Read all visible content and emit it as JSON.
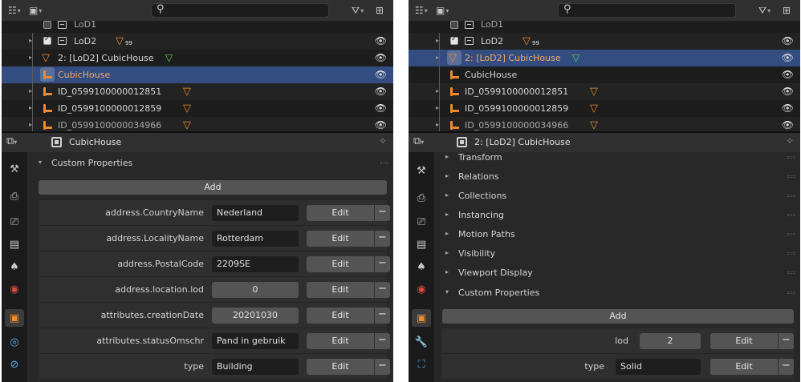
{
  "outliner": {
    "rows": [
      {
        "label": "LoD1"
      },
      {
        "label": "LoD2",
        "badge": "99"
      },
      {
        "label": "2: [LoD2] CubicHouse"
      },
      {
        "label": "CubicHouse"
      },
      {
        "label": "ID_0599100000012851"
      },
      {
        "label": "ID_0599100000012859"
      },
      {
        "label": "ID_0599100000034966"
      }
    ]
  },
  "left": {
    "header_title": "CubicHouse",
    "section": "Custom Properties",
    "add_label": "Add",
    "edit_label": "Edit",
    "remove_label": "−",
    "props": [
      {
        "key": "address.CountryName",
        "value": "Nederland"
      },
      {
        "key": "address.LocalityName",
        "value": "Rotterdam"
      },
      {
        "key": "address.PostalCode",
        "value": "2209SE"
      },
      {
        "key": "address.location.lod",
        "value": "0"
      },
      {
        "key": "attributes.creationDate",
        "value": "20201030"
      },
      {
        "key": "attributes.statusOmschr",
        "value": "Pand in gebruik"
      },
      {
        "key": "type",
        "value": "Building"
      }
    ]
  },
  "right": {
    "header_title": "2: [LoD2] CubicHouse",
    "sections": [
      "Transform",
      "Relations",
      "Collections",
      "Instancing",
      "Motion Paths",
      "Visibility",
      "Viewport Display"
    ],
    "custom_section": "Custom Properties",
    "add_label": "Add",
    "edit_label": "Edit",
    "remove_label": "−",
    "props": [
      {
        "key": "lod",
        "value": "2"
      },
      {
        "key": "type",
        "value": "Solid"
      }
    ]
  },
  "icons": {
    "editor_type": "outliner-icon",
    "display_mode": "view-layer-icon",
    "search": "search-icon",
    "filter": "filter-icon",
    "new_collection": "new-collection-icon",
    "visibility": "eye-icon",
    "pin": "pin-icon"
  },
  "colors": {
    "selection": "#334d80",
    "object_orange": "#ee8a2f",
    "mesh_green": "#5fd35f",
    "panel_bg": "#1d1d1d"
  }
}
